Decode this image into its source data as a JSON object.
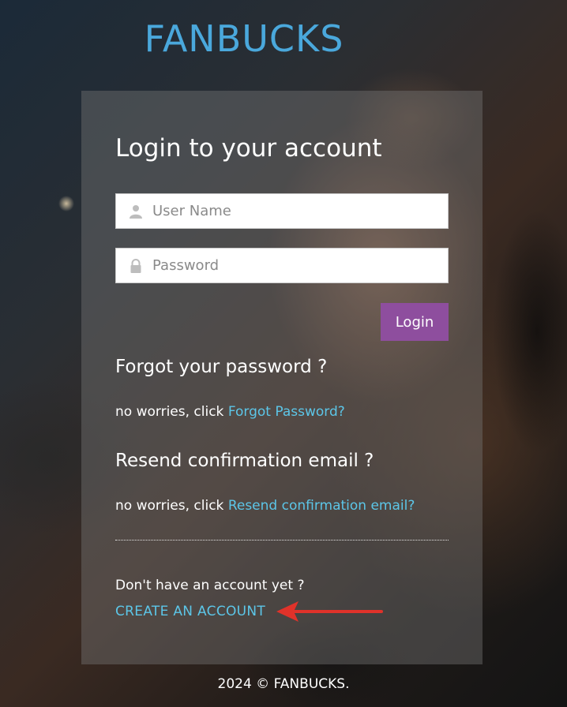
{
  "brand": {
    "logo_text": "FANBUCKS",
    "logo_color": "#4aa8dc"
  },
  "login": {
    "title": "Login to your account",
    "username_placeholder": "User Name",
    "username_icon": "user-icon",
    "password_placeholder": "Password",
    "password_icon": "lock-icon",
    "button_label": "Login",
    "button_color": "#8e4e9e"
  },
  "forgot": {
    "heading": "Forgot your password ?",
    "prefix": "no worries, click ",
    "link": "Forgot Password?"
  },
  "resend": {
    "heading": "Resend confirmation email ?",
    "prefix": "no worries, click ",
    "link": "Resend confirmation email?"
  },
  "signup": {
    "question": "Don't have an account yet ?",
    "link": "CREATE AN ACCOUNT",
    "arrow_color": "#e0322a"
  },
  "link_color": "#5cc6e8",
  "footer": {
    "text": "2024 © FANBUCKS."
  }
}
